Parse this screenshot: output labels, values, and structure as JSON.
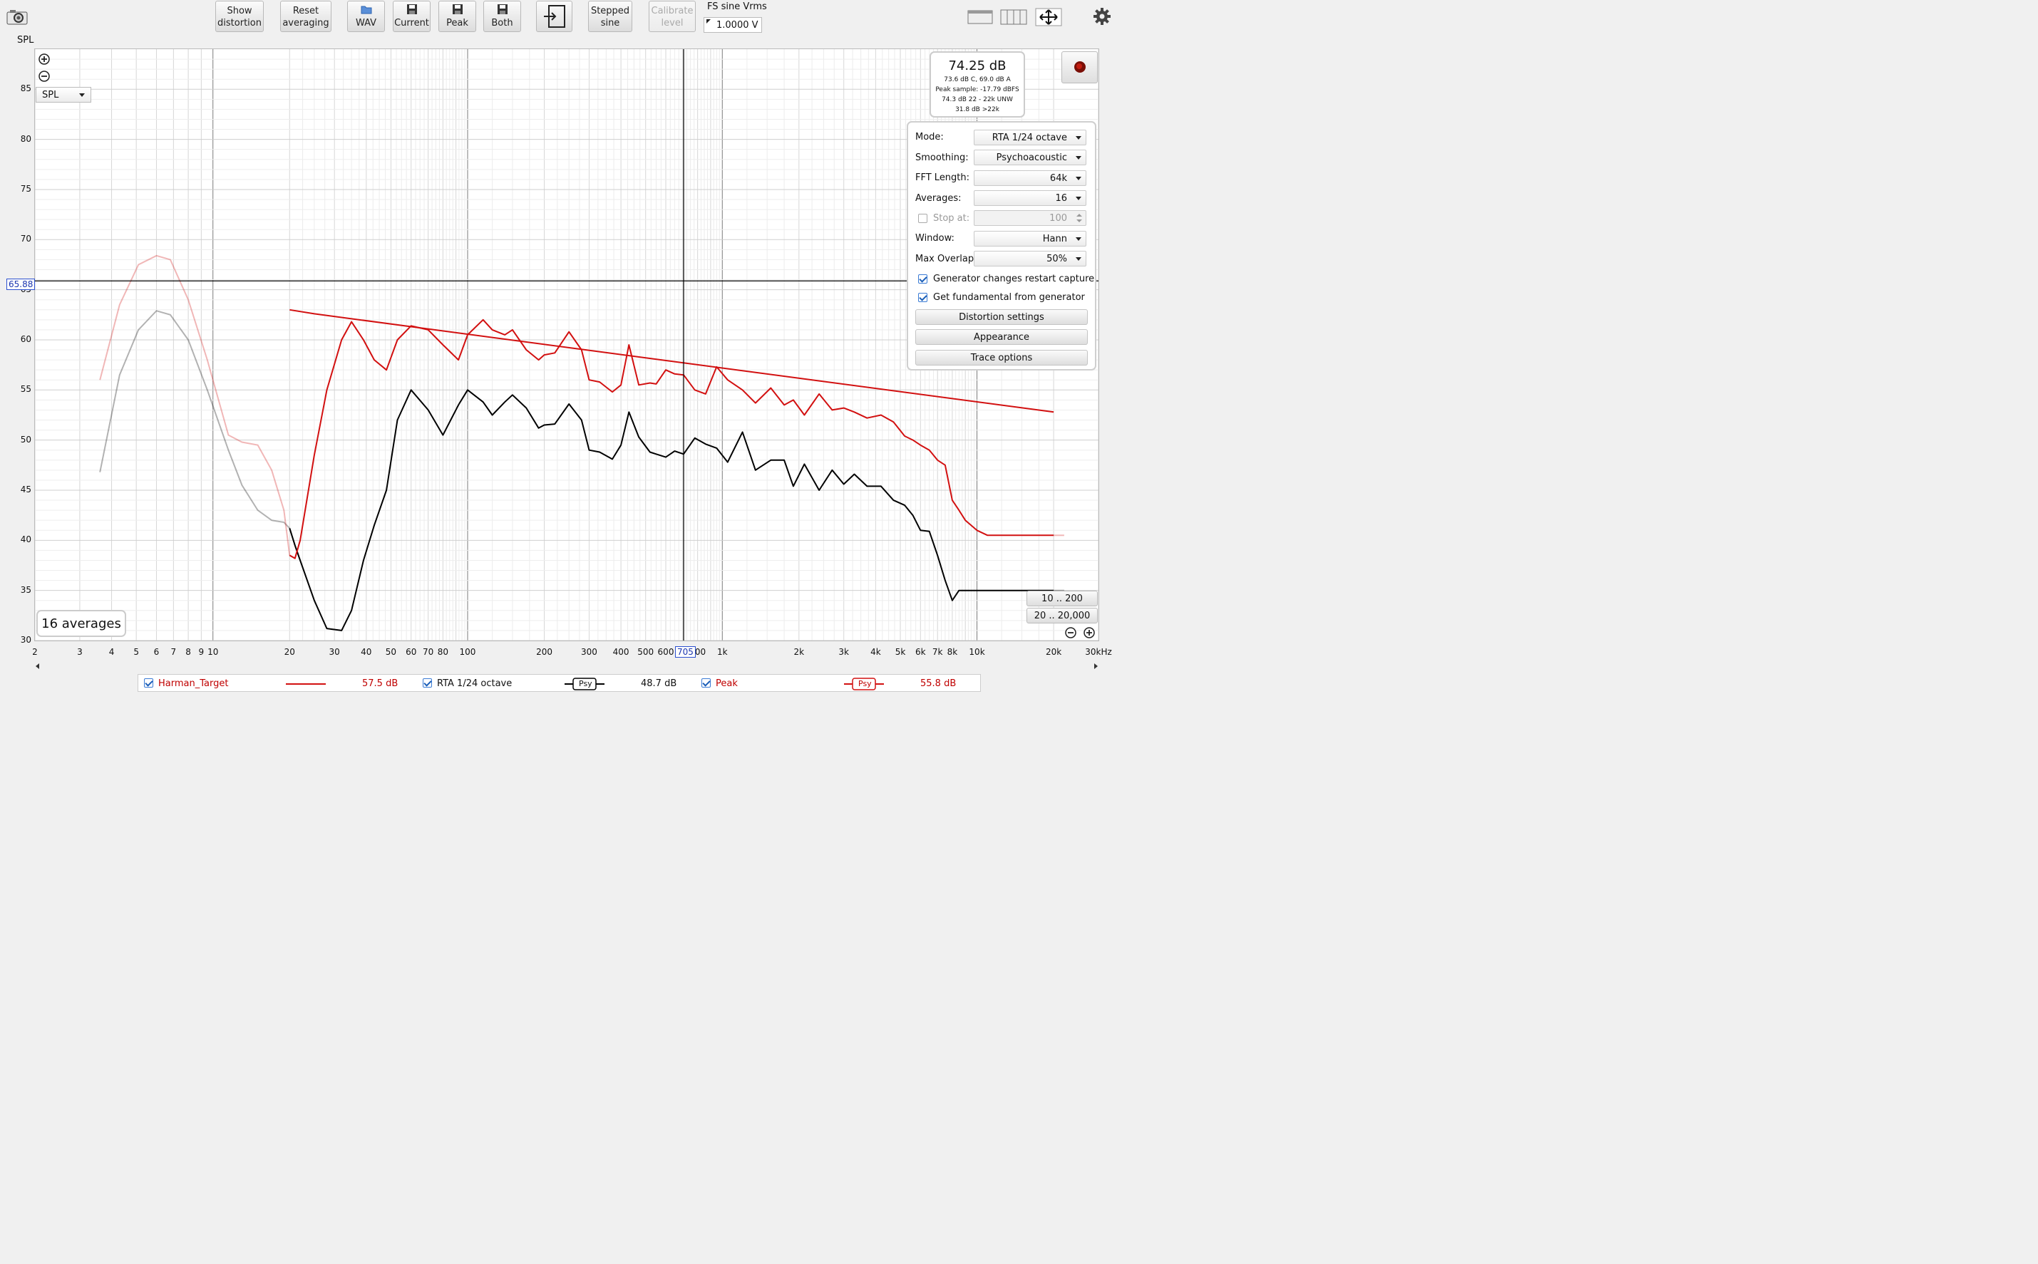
{
  "toolbar": {
    "show_distortion": [
      "Show",
      "distortion"
    ],
    "reset_averaging": [
      "Reset",
      "averaging"
    ],
    "wav": "WAV",
    "current": "Current",
    "peak": "Peak",
    "both": "Both",
    "stepped_sine": [
      "Stepped",
      "sine"
    ],
    "calibrate_level": [
      "Calibrate",
      "level"
    ],
    "fs_sine_label": "FS sine Vrms",
    "fs_sine_value": "1.0000 V"
  },
  "plot": {
    "y_axis_title": "SPL",
    "unit_select": "SPL",
    "cursor_y_label": "65.88",
    "cursor_x_label": "705",
    "averages_badge": "16 averages",
    "range_buttons": [
      "10 .. 200",
      "20 .. 20,000"
    ]
  },
  "level_meter": {
    "main": "74.25 dB",
    "lines": [
      "73.6 dB C, 69.0 dB A",
      "Peak sample: -17.79 dBFS",
      "74.3 dB 22 - 22k UNW",
      "31.8 dB >22k"
    ]
  },
  "settings": {
    "mode_label": "Mode:",
    "mode_value": "RTA 1/24 octave",
    "smoothing_label": "Smoothing:",
    "smoothing_value": "Psychoacoustic",
    "fft_label": "FFT Length:",
    "fft_value": "64k",
    "averages_label": "Averages:",
    "averages_value": "16",
    "stop_at_label": "Stop at:",
    "stop_at_value": "100",
    "window_label": "Window:",
    "window_value": "Hann",
    "overlap_label": "Max Overlap:",
    "overlap_value": "50%",
    "gen_restart_label": "Generator changes restart capture",
    "gen_fundamental_label": "Get fundamental from generator",
    "distortion_settings": "Distortion settings",
    "appearance": "Appearance",
    "trace_options": "Trace options"
  },
  "legend": {
    "harman_name": "Harman_Target",
    "harman_value": "57.5 dB",
    "rta_name": "RTA 1/24 octave",
    "rta_value": "48.7 dB",
    "rta_tag": "Psy",
    "peak_name": "Peak",
    "peak_value": "55.8 dB",
    "peak_tag": "Psy"
  },
  "colors": {
    "harman": "#d21010",
    "rta": "#000000",
    "peak": "#d21010",
    "cursor": "#000000",
    "accent": "#1c5fb8"
  },
  "chart_data": {
    "type": "line",
    "ylabel": "SPL",
    "ylim": [
      30,
      89
    ],
    "xlim": [
      2,
      30000
    ],
    "xscale": "log",
    "x_tick_labels": [
      "2",
      "3",
      "4",
      "5",
      "6",
      "7",
      "8",
      "9",
      "10",
      "20",
      "30",
      "40",
      "50",
      "60",
      "70",
      "80",
      "100",
      "200",
      "300",
      "400",
      "500",
      "600",
      "800",
      "1k",
      "2k",
      "3k",
      "4k",
      "5k",
      "6k",
      "7k",
      "8k",
      "10k",
      "20k",
      "30kHz"
    ],
    "y_tick_labels": [
      "30",
      "35",
      "40",
      "45",
      "50",
      "55",
      "60",
      "65",
      "70",
      "75",
      "80",
      "85"
    ],
    "cursor": {
      "x": 705,
      "y": 65.88
    },
    "series": [
      {
        "name": "Harman_Target",
        "x": [
          20,
          25,
          20000
        ],
        "y": [
          63.0,
          62.6,
          52.8
        ]
      },
      {
        "name": "RTA 1/24 octave",
        "x": [
          3.6,
          4.3,
          5.1,
          6.0,
          6.8,
          8.0,
          9.5,
          11.5,
          13,
          15,
          17,
          19,
          20,
          21,
          22,
          25,
          28,
          32,
          35,
          39,
          43,
          48,
          53,
          60,
          70,
          80,
          92,
          100,
          115,
          125,
          140,
          150,
          170,
          190,
          200,
          220,
          250,
          280,
          300,
          330,
          370,
          400,
          430,
          470,
          520,
          550,
          600,
          650,
          705,
          780,
          860,
          950,
          1050,
          1200,
          1350,
          1550,
          1750,
          1900,
          2100,
          2400,
          2700,
          3000,
          3300,
          3700,
          4200,
          4700,
          5200,
          5600,
          6000,
          6500,
          7000,
          7500,
          8000,
          8500,
          9000,
          10000,
          11000,
          13000,
          15000,
          17000,
          19000,
          20000,
          22000
        ],
        "y": [
          46.8,
          56.5,
          61,
          62.9,
          62.5,
          60,
          55,
          49,
          45.5,
          43,
          42,
          41.8,
          41.2,
          39.5,
          38,
          34,
          31.2,
          31,
          33,
          38,
          41.5,
          45,
          52,
          55,
          53,
          50.5,
          53.5,
          55,
          53.8,
          52.5,
          53.8,
          54.5,
          53.2,
          51.2,
          51.5,
          51.6,
          53.6,
          52,
          49,
          48.8,
          48.1,
          49.5,
          52.8,
          50.3,
          48.8,
          48.6,
          48.3,
          48.9,
          48.6,
          50.2,
          49.6,
          49.2,
          47.8,
          50.8,
          47,
          48,
          48,
          45.4,
          47.6,
          45,
          47,
          45.6,
          46.6,
          45.4,
          45.4,
          44,
          43.5,
          42.5,
          41,
          40.9,
          38.5,
          36,
          34,
          35,
          35,
          35,
          35,
          35,
          35,
          35,
          35,
          35,
          35
        ]
      },
      {
        "name": "Peak",
        "x": [
          3.6,
          4.3,
          5.1,
          6.0,
          6.8,
          8.0,
          9.5,
          11.5,
          13,
          15,
          17,
          19,
          20,
          21,
          22,
          25,
          28,
          32,
          35,
          39,
          43,
          48,
          53,
          60,
          70,
          80,
          92,
          100,
          115,
          125,
          140,
          150,
          170,
          190,
          200,
          220,
          250,
          280,
          300,
          330,
          370,
          400,
          430,
          470,
          520,
          550,
          600,
          650,
          705,
          780,
          860,
          950,
          1050,
          1200,
          1350,
          1550,
          1750,
          1900,
          2100,
          2400,
          2700,
          3000,
          3300,
          3700,
          4200,
          4700,
          5200,
          5600,
          6000,
          6500,
          7000,
          7500,
          8000,
          8500,
          9000,
          10000,
          11000,
          13000,
          15000,
          17000,
          19000,
          20000,
          22000
        ],
        "y": [
          56,
          63.5,
          67.5,
          68.4,
          68,
          64,
          58,
          50.5,
          49.8,
          49.5,
          47,
          43,
          38.5,
          38.2,
          40,
          48.5,
          55,
          60,
          61.8,
          60,
          58,
          57,
          60,
          61.4,
          61,
          59.5,
          58,
          60.5,
          62,
          61,
          60.5,
          61,
          59,
          58,
          58.5,
          58.7,
          60.8,
          59,
          56,
          55.8,
          54.8,
          55.5,
          59.5,
          55.5,
          55.7,
          55.6,
          57,
          56.6,
          56.5,
          55,
          54.6,
          57.3,
          56,
          55,
          53.7,
          55.2,
          53.5,
          54,
          52.5,
          54.6,
          53,
          53.2,
          52.8,
          52.2,
          52.5,
          51.8,
          50.4,
          50,
          49.5,
          49,
          48,
          47.5,
          44,
          43,
          42,
          41,
          40.5,
          40.5,
          40.5,
          40.5,
          40.5,
          40.5,
          40.5
        ]
      }
    ]
  }
}
